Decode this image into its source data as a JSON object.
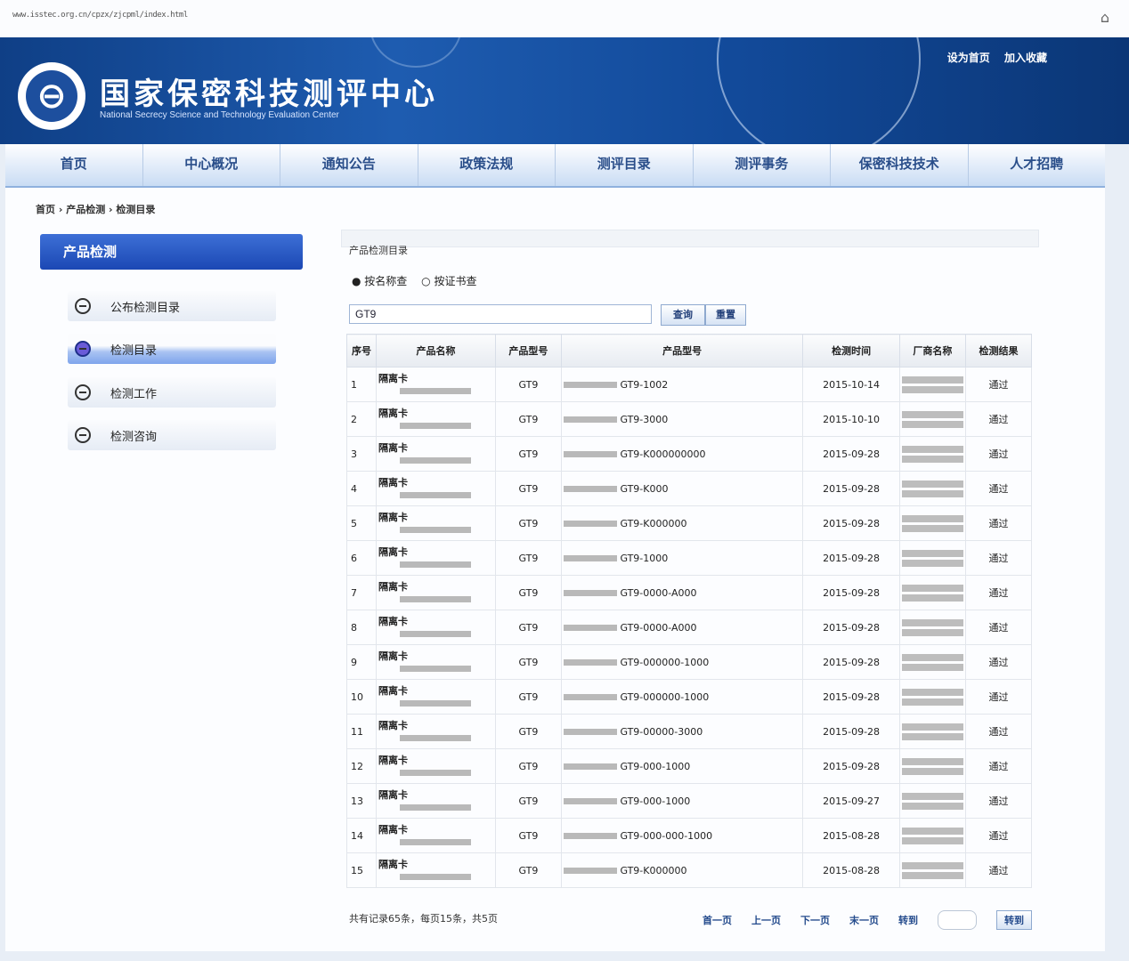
{
  "browser": {
    "url": "www.isstec.org.cn/cpzx/zjcpml/index.html"
  },
  "header": {
    "title": "国家保密科技测评中心",
    "subtitle": "National Secrecy Science and Technology Evaluation Center",
    "links": [
      "设为首页",
      "加入收藏"
    ]
  },
  "nav": [
    "首页",
    "中心概况",
    "通知公告",
    "政策法规",
    "测评目录",
    "测评事务",
    "保密科技技术",
    "人才招聘"
  ],
  "breadcrumb": "首页 › 产品检测 › 检测目录",
  "sidebar": {
    "title": "产品检测",
    "items": [
      {
        "label": "公布检测目录"
      },
      {
        "label": "检测目录"
      },
      {
        "label": "检测工作"
      },
      {
        "label": "检测咨询"
      }
    ]
  },
  "main": {
    "box_title": "产品检测目录",
    "radios": [
      "按名称查",
      "按证书查"
    ],
    "search_value": "GT9",
    "buttons": [
      "查询",
      "重置"
    ],
    "columns": [
      "序号",
      "产品名称",
      "产品型号",
      "产品型号",
      "检测时间",
      "厂商名称",
      "检测结果"
    ],
    "rows": [
      {
        "idx": "1",
        "name": "隔离卡",
        "model": "GT9",
        "spec": "GT9-1002",
        "date": "2015-10-14",
        "result": "通过"
      },
      {
        "idx": "2",
        "name": "隔离卡",
        "model": "GT9",
        "spec": "GT9-3000",
        "date": "2015-10-10",
        "result": "通过"
      },
      {
        "idx": "3",
        "name": "隔离卡",
        "model": "GT9",
        "spec": "GT9-K000000000",
        "date": "2015-09-28",
        "result": "通过"
      },
      {
        "idx": "4",
        "name": "隔离卡",
        "model": "GT9",
        "spec": "GT9-K000",
        "date": "2015-09-28",
        "result": "通过"
      },
      {
        "idx": "5",
        "name": "隔离卡",
        "model": "GT9",
        "spec": "GT9-K000000",
        "date": "2015-09-28",
        "result": "通过"
      },
      {
        "idx": "6",
        "name": "隔离卡",
        "model": "GT9",
        "spec": "GT9-1000",
        "date": "2015-09-28",
        "result": "通过"
      },
      {
        "idx": "7",
        "name": "隔离卡",
        "model": "GT9",
        "spec": "GT9-0000-A000",
        "date": "2015-09-28",
        "result": "通过"
      },
      {
        "idx": "8",
        "name": "隔离卡",
        "model": "GT9",
        "spec": "GT9-0000-A000",
        "date": "2015-09-28",
        "result": "通过"
      },
      {
        "idx": "9",
        "name": "隔离卡",
        "model": "GT9",
        "spec": "GT9-000000-1000",
        "date": "2015-09-28",
        "result": "通过"
      },
      {
        "idx": "10",
        "name": "隔离卡",
        "model": "GT9",
        "spec": "GT9-000000-1000",
        "date": "2015-09-28",
        "result": "通过"
      },
      {
        "idx": "11",
        "name": "隔离卡",
        "model": "GT9",
        "spec": "GT9-00000-3000",
        "date": "2015-09-28",
        "result": "通过"
      },
      {
        "idx": "12",
        "name": "隔离卡",
        "model": "GT9",
        "spec": "GT9-000-1000",
        "date": "2015-09-28",
        "result": "通过"
      },
      {
        "idx": "13",
        "name": "隔离卡",
        "model": "GT9",
        "spec": "GT9-000-1000",
        "date": "2015-09-27",
        "result": "通过"
      },
      {
        "idx": "14",
        "name": "隔离卡",
        "model": "GT9",
        "spec": "GT9-000-000-1000",
        "date": "2015-08-28",
        "result": "通过"
      },
      {
        "idx": "15",
        "name": "隔离卡",
        "model": "GT9",
        "spec": "GT9-K000000",
        "date": "2015-08-28",
        "result": "通过"
      }
    ],
    "footer_info": "共有记录65条，每页15条，共5页",
    "pager": [
      "首一页",
      "上一页",
      "下一页",
      "末一页",
      "转到"
    ],
    "go_label": "转到"
  }
}
